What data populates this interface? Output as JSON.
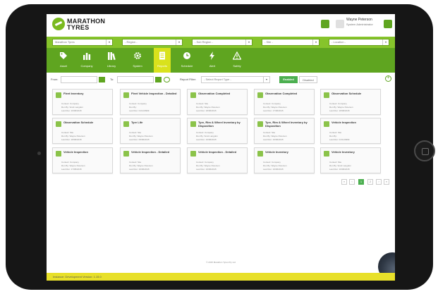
{
  "brand": {
    "name_line1": "MARATHON",
    "name_line2": "TYRES",
    "color": "#7aba1f"
  },
  "user": {
    "name": "Wayne Peterson",
    "role": "System Administrator"
  },
  "filters": [
    {
      "label": "Marathon Tyres"
    },
    {
      "label": "- Region -"
    },
    {
      "label": "- Sub Region -"
    },
    {
      "label": "- Site -"
    },
    {
      "label": "- Location -"
    }
  ],
  "nav": [
    {
      "label": "Asset",
      "icon": "tag-icon"
    },
    {
      "label": "Company",
      "icon": "bar-chart-icon"
    },
    {
      "label": "Library",
      "icon": "library-icon"
    },
    {
      "label": "System",
      "icon": "gear-icon"
    },
    {
      "label": "Reports",
      "icon": "report-icon"
    },
    {
      "label": "Schedule",
      "icon": "clock-icon"
    },
    {
      "label": "Alert",
      "icon": "lightning-icon"
    },
    {
      "label": "Safety",
      "icon": "warning-icon"
    }
  ],
  "date_filter": {
    "from_label": "From:",
    "to_label": "To:",
    "report_filter_label": "Report Filter:",
    "report_type_placeholder": "- Select Report Type -",
    "enabled_label": "Enabled",
    "disabled_label": "Disabled"
  },
  "reports": [
    {
      "title": "Fleet Inventory",
      "lines": [
        "Context: Company",
        "Run By: Scott Langdon",
        "Last Run: 16/06/2015"
      ]
    },
    {
      "title": "Fleet Vehicle Inspection - Detailed",
      "lines": [
        "Context: Company",
        "Run By:",
        "Last Run: 01/11/0999"
      ]
    },
    {
      "title": "Observation Completed",
      "lines": [
        "Context: Site",
        "Run By: Wayne Peterson",
        "Last Run: 18/06/2015"
      ]
    },
    {
      "title": "Observation Completed",
      "lines": [
        "Context: Company",
        "Run By: Wayne Peterson",
        "Last Run: 17/06/2015"
      ]
    },
    {
      "title": "Observation Schedule",
      "lines": [
        "Context: Company",
        "Run By: Wayne Peterson",
        "Last Run: 18/06/2015"
      ]
    },
    {
      "title": "Observation Schedule",
      "lines": [
        "Context: Site",
        "Run By: Wayne Peterson",
        "Last Run: 18/06/2015"
      ]
    },
    {
      "title": "Tyre Life",
      "lines": [
        "Context: Site",
        "Run By: Wayne Peterson",
        "Last Run: 05/06/2015"
      ]
    },
    {
      "title": "Tyre, Rim & Wheel Inventory by Disposition",
      "lines": [
        "Context: Company",
        "Run By: Scott Langdon",
        "Last Run: 16/06/2015"
      ]
    },
    {
      "title": "Tyre, Rim & Wheel Inventory by Disposition",
      "lines": [
        "Context: Site",
        "Run By: Wayne Peterson",
        "Last Run: 16/06/2015"
      ]
    },
    {
      "title": "Vehicle Inspection",
      "lines": [
        "Context: Site",
        "Run By:",
        "Last Run: 01/11/0999"
      ]
    },
    {
      "title": "Vehicle Inspection",
      "lines": [
        "Context: Company",
        "Run By: Wayne Peterson",
        "Last Run: 17/05/2015"
      ]
    },
    {
      "title": "Vehicle Inspection - Detailed",
      "lines": [
        "Context: Site",
        "Run By: Wayne Peterson",
        "Last Run: 16/06/2015"
      ]
    },
    {
      "title": "Vehicle Inspection - Detailed",
      "lines": [
        "Context: Company",
        "Run By: Wayne Peterson",
        "Last Run: 16/06/2015"
      ]
    },
    {
      "title": "Vehicle Inventory",
      "lines": [
        "Context: Company",
        "Run By: Wayne Peterson",
        "Last Run: 16/06/2015"
      ]
    },
    {
      "title": "Vehicle Inventory",
      "lines": [
        "Context: Site",
        "Run By: Scott Langdon",
        "Last Run: 16/06/2015"
      ]
    }
  ],
  "pagination": {
    "first": "«",
    "prev": "‹",
    "current": "1",
    "next_page": "2",
    "next": "›",
    "last": "»"
  },
  "footer": {
    "copyright": "© 2015 Marathon Tyres Pty Ltd",
    "status": "Instance: Development    Version: 1.15.0"
  },
  "colors": {
    "nav_green": "#5fa520",
    "filter_green": "#86c42b",
    "active_tab": "#d9e21c",
    "status_yellow": "#e8e02a"
  }
}
